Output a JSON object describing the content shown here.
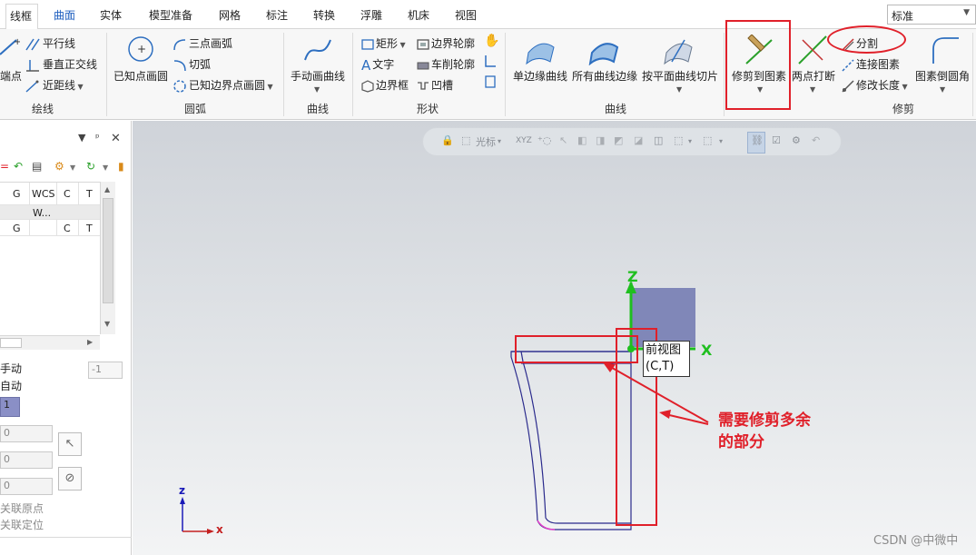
{
  "tabs": [
    "线框",
    "曲面",
    "实体",
    "模型准备",
    "网格",
    "标注",
    "转换",
    "浮雕",
    "机床",
    "视图"
  ],
  "preset": "标准",
  "ribbon": {
    "line_group": {
      "label": "绘线",
      "endpoint": "端点",
      "parallel": "平行线",
      "perpendicular": "垂直正交线",
      "closest": "近距线"
    },
    "arc_group": {
      "label": "圆弧",
      "circle_known_point": "已知点画圆",
      "three_point_arc": "三点画弧",
      "tangent_arc": "切弧",
      "boundary_circle": "已知边界点画圆"
    },
    "curve_group": {
      "label": "曲线",
      "manual_curve": "手动画曲线"
    },
    "shape_group": {
      "label": "形状",
      "rectangle": "矩形",
      "text": "文字",
      "bounding_box": "边界框",
      "boundary_profile": "边界轮廓",
      "turn_profile": "车削轮廓",
      "groove": "凹槽"
    },
    "curve2_group": {
      "label": "曲线",
      "single_edge": "单边缘曲线",
      "all_edges": "所有曲线边缘",
      "plane_cut": "按平面曲线切片"
    },
    "trim_group": {
      "label": "修剪",
      "trim_to_entity": "修剪到图素",
      "two_point_break": "两点打断",
      "divide": "分割",
      "join": "连接图素",
      "modify_length": "修改长度",
      "fillet": "图素倒圆角"
    }
  },
  "left_panel": {
    "columns": [
      "G",
      "WCS",
      "C",
      "T"
    ],
    "row1": [
      "W..."
    ],
    "row2": [
      "G",
      "",
      "C",
      "T"
    ],
    "manual": "手动",
    "auto": "自动",
    "number_value": "-1",
    "selected_value": "1",
    "field1": "0",
    "field2": "0",
    "field3": "0",
    "assoc_origin": "关联原点",
    "assoc_position": "关联定位"
  },
  "viewport": {
    "toolbar_cursor": "光标",
    "toolbar_xyz": "XYZ",
    "view_name": "前视图",
    "view_planes": "(C,T)",
    "axis_z": "Z",
    "axis_x": "X",
    "mini_z": "z",
    "mini_x": "x",
    "annotation_line1": "需要修剪多余",
    "annotation_line2": "的部分"
  },
  "watermark": "CSDN @中微中",
  "colors": {
    "accent": "#1f5fbf",
    "annotation_red": "#e0202a",
    "axis_green": "#1fbf1f",
    "plane_fill": "#8087b8",
    "profile_blue": "#2a2a8c"
  }
}
